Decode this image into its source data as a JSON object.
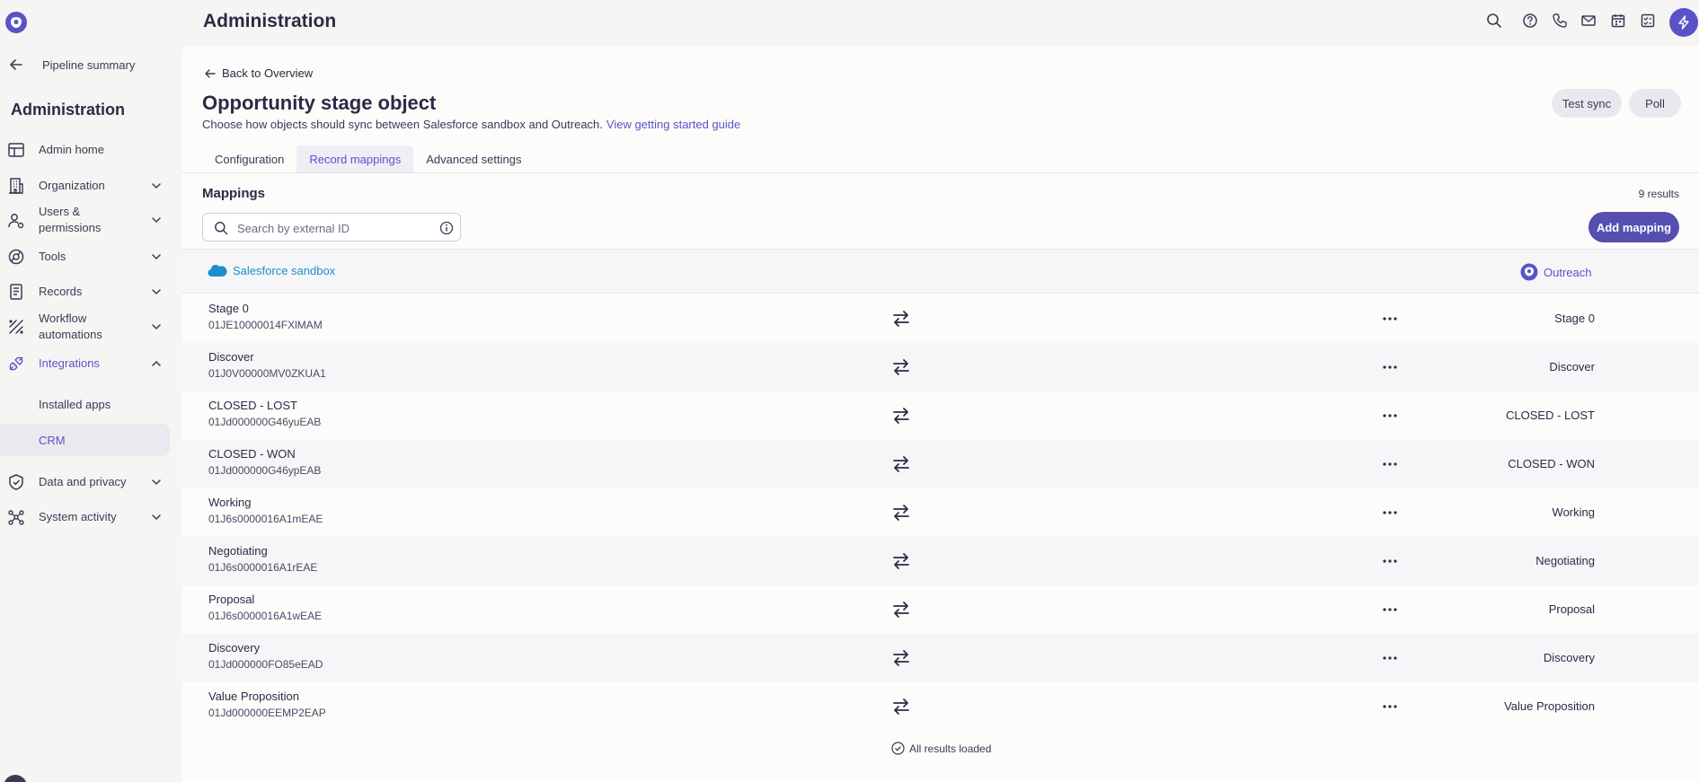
{
  "colors": {
    "accent": "#5a53c7",
    "salesforce": "#1a8fc9"
  },
  "topbar": {
    "title": "Administration",
    "icons": [
      "search-icon",
      "help-icon",
      "phone-icon",
      "mail-icon",
      "calendar-icon",
      "tasks-icon",
      "bolt-icon"
    ]
  },
  "sidebar": {
    "back_label": "Pipeline summary",
    "title": "Administration",
    "items": [
      {
        "label": "Admin home",
        "icon": "layout-icon"
      },
      {
        "label": "Organization",
        "icon": "building-icon"
      },
      {
        "label": "Users &",
        "label2": "permissions",
        "icon": "users-icon"
      },
      {
        "label": "Tools",
        "icon": "tools-icon"
      },
      {
        "label": "Records",
        "icon": "records-icon"
      },
      {
        "label": "Workflow",
        "label2": "automations",
        "icon": "workflow-icon"
      },
      {
        "label": "Integrations",
        "icon": "plug-icon"
      },
      {
        "label": "Data and privacy",
        "icon": "shield-icon"
      },
      {
        "label": "System activity",
        "icon": "activity-icon"
      }
    ],
    "sub_items": [
      {
        "label": "Installed apps"
      },
      {
        "label": "CRM"
      }
    ]
  },
  "main": {
    "back_link": "Back to Overview",
    "title": "Opportunity stage object",
    "description": "Choose how objects should sync between Salesforce sandbox and Outreach.",
    "guide_link": "View getting started guide",
    "test_sync": "Test sync",
    "poll": "Poll",
    "tabs": [
      {
        "label": "Configuration"
      },
      {
        "label": "Record mappings"
      },
      {
        "label": "Advanced settings"
      }
    ],
    "mappings_title": "Mappings",
    "result_count": "9 results",
    "search_placeholder": "Search by external ID",
    "add_mapping": "Add mapping",
    "source_header": "Salesforce sandbox",
    "target_header": "Outreach",
    "rows": [
      {
        "name": "Stage 0",
        "external_id": "01JE10000014FXlMAM",
        "target": "Stage 0"
      },
      {
        "name": "Discover",
        "external_id": "01J0V00000MV0ZKUA1",
        "target": "Discover"
      },
      {
        "name": "CLOSED - LOST",
        "external_id": "01Jd000000G46yuEAB",
        "target": "CLOSED - LOST"
      },
      {
        "name": "CLOSED - WON",
        "external_id": "01Jd000000G46ypEAB",
        "target": "CLOSED - WON"
      },
      {
        "name": "Working",
        "external_id": "01J6s0000016A1mEAE",
        "target": "Working"
      },
      {
        "name": "Negotiating",
        "external_id": "01J6s0000016A1rEAE",
        "target": "Negotiating"
      },
      {
        "name": "Proposal",
        "external_id": "01J6s0000016A1wEAE",
        "target": "Proposal"
      },
      {
        "name": "Discovery",
        "external_id": "01Jd000000FO85eEAD",
        "target": "Discovery"
      },
      {
        "name": "Value Proposition",
        "external_id": "01Jd000000EEMP2EAP",
        "target": "Value Proposition"
      }
    ],
    "all_loaded": "All results loaded"
  }
}
